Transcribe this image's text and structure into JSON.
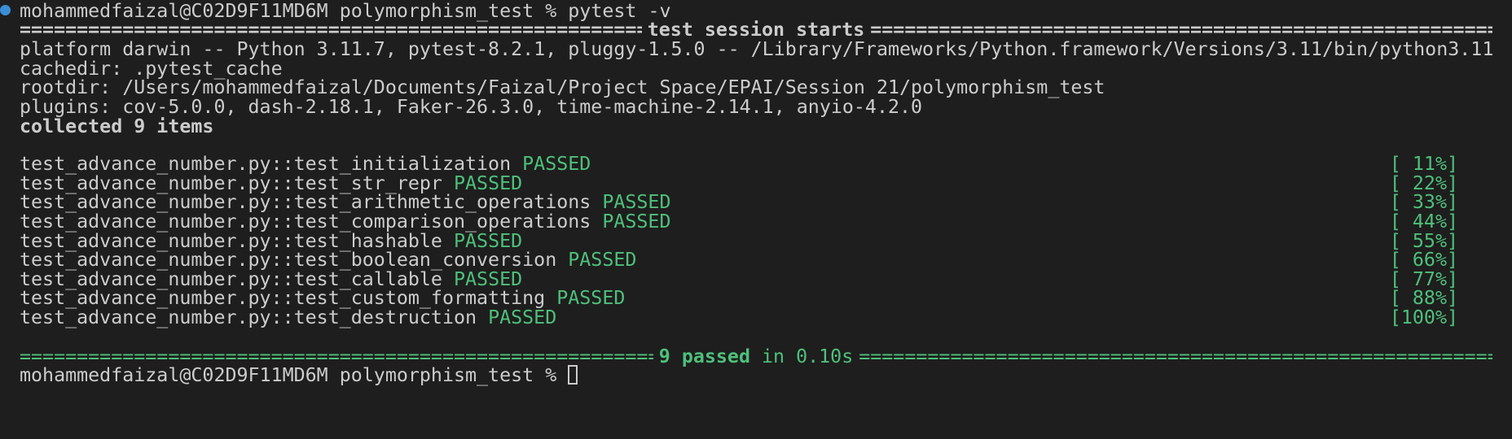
{
  "prompt": {
    "user_host": "mohammedfaizal@C02D9F11MD6M",
    "cwd": "polymorphism_test",
    "symbol": "%",
    "command": "pytest -v"
  },
  "session_header": "test session starts",
  "info": {
    "platform": "platform darwin -- Python 3.11.7, pytest-8.2.1, pluggy-1.5.0 -- /Library/Frameworks/Python.framework/Versions/3.11/bin/python3.11",
    "cachedir": "cachedir: .pytest_cache",
    "rootdir": "rootdir: /Users/mohammedfaizal/Documents/Faizal/Project Space/EPAI/Session 21/polymorphism_test",
    "plugins": "plugins: cov-5.0.0, dash-2.18.1, Faker-26.3.0, time-machine-2.14.1, anyio-4.2.0",
    "collected": "collected 9 items"
  },
  "tests": [
    {
      "name": "test_advance_number.py::test_initialization",
      "status": "PASSED",
      "progress": "[ 11%]"
    },
    {
      "name": "test_advance_number.py::test_str_repr",
      "status": "PASSED",
      "progress": "[ 22%]"
    },
    {
      "name": "test_advance_number.py::test_arithmetic_operations",
      "status": "PASSED",
      "progress": "[ 33%]"
    },
    {
      "name": "test_advance_number.py::test_comparison_operations",
      "status": "PASSED",
      "progress": "[ 44%]"
    },
    {
      "name": "test_advance_number.py::test_hashable",
      "status": "PASSED",
      "progress": "[ 55%]"
    },
    {
      "name": "test_advance_number.py::test_boolean_conversion",
      "status": "PASSED",
      "progress": "[ 66%]"
    },
    {
      "name": "test_advance_number.py::test_callable",
      "status": "PASSED",
      "progress": "[ 77%]"
    },
    {
      "name": "test_advance_number.py::test_custom_formatting",
      "status": "PASSED",
      "progress": "[ 88%]"
    },
    {
      "name": "test_advance_number.py::test_destruction",
      "status": "PASSED",
      "progress": "[100%]"
    }
  ],
  "summary": {
    "passed": "9 passed",
    "duration": "in 0.10s"
  },
  "prompt2": {
    "text": "mohammedfaizal@C02D9F11MD6M polymorphism_test % "
  },
  "colors": {
    "background": "#1e1e1e",
    "foreground": "#cccccc",
    "passed": "#4ec07a",
    "status_dot": "#3b8ed6"
  }
}
